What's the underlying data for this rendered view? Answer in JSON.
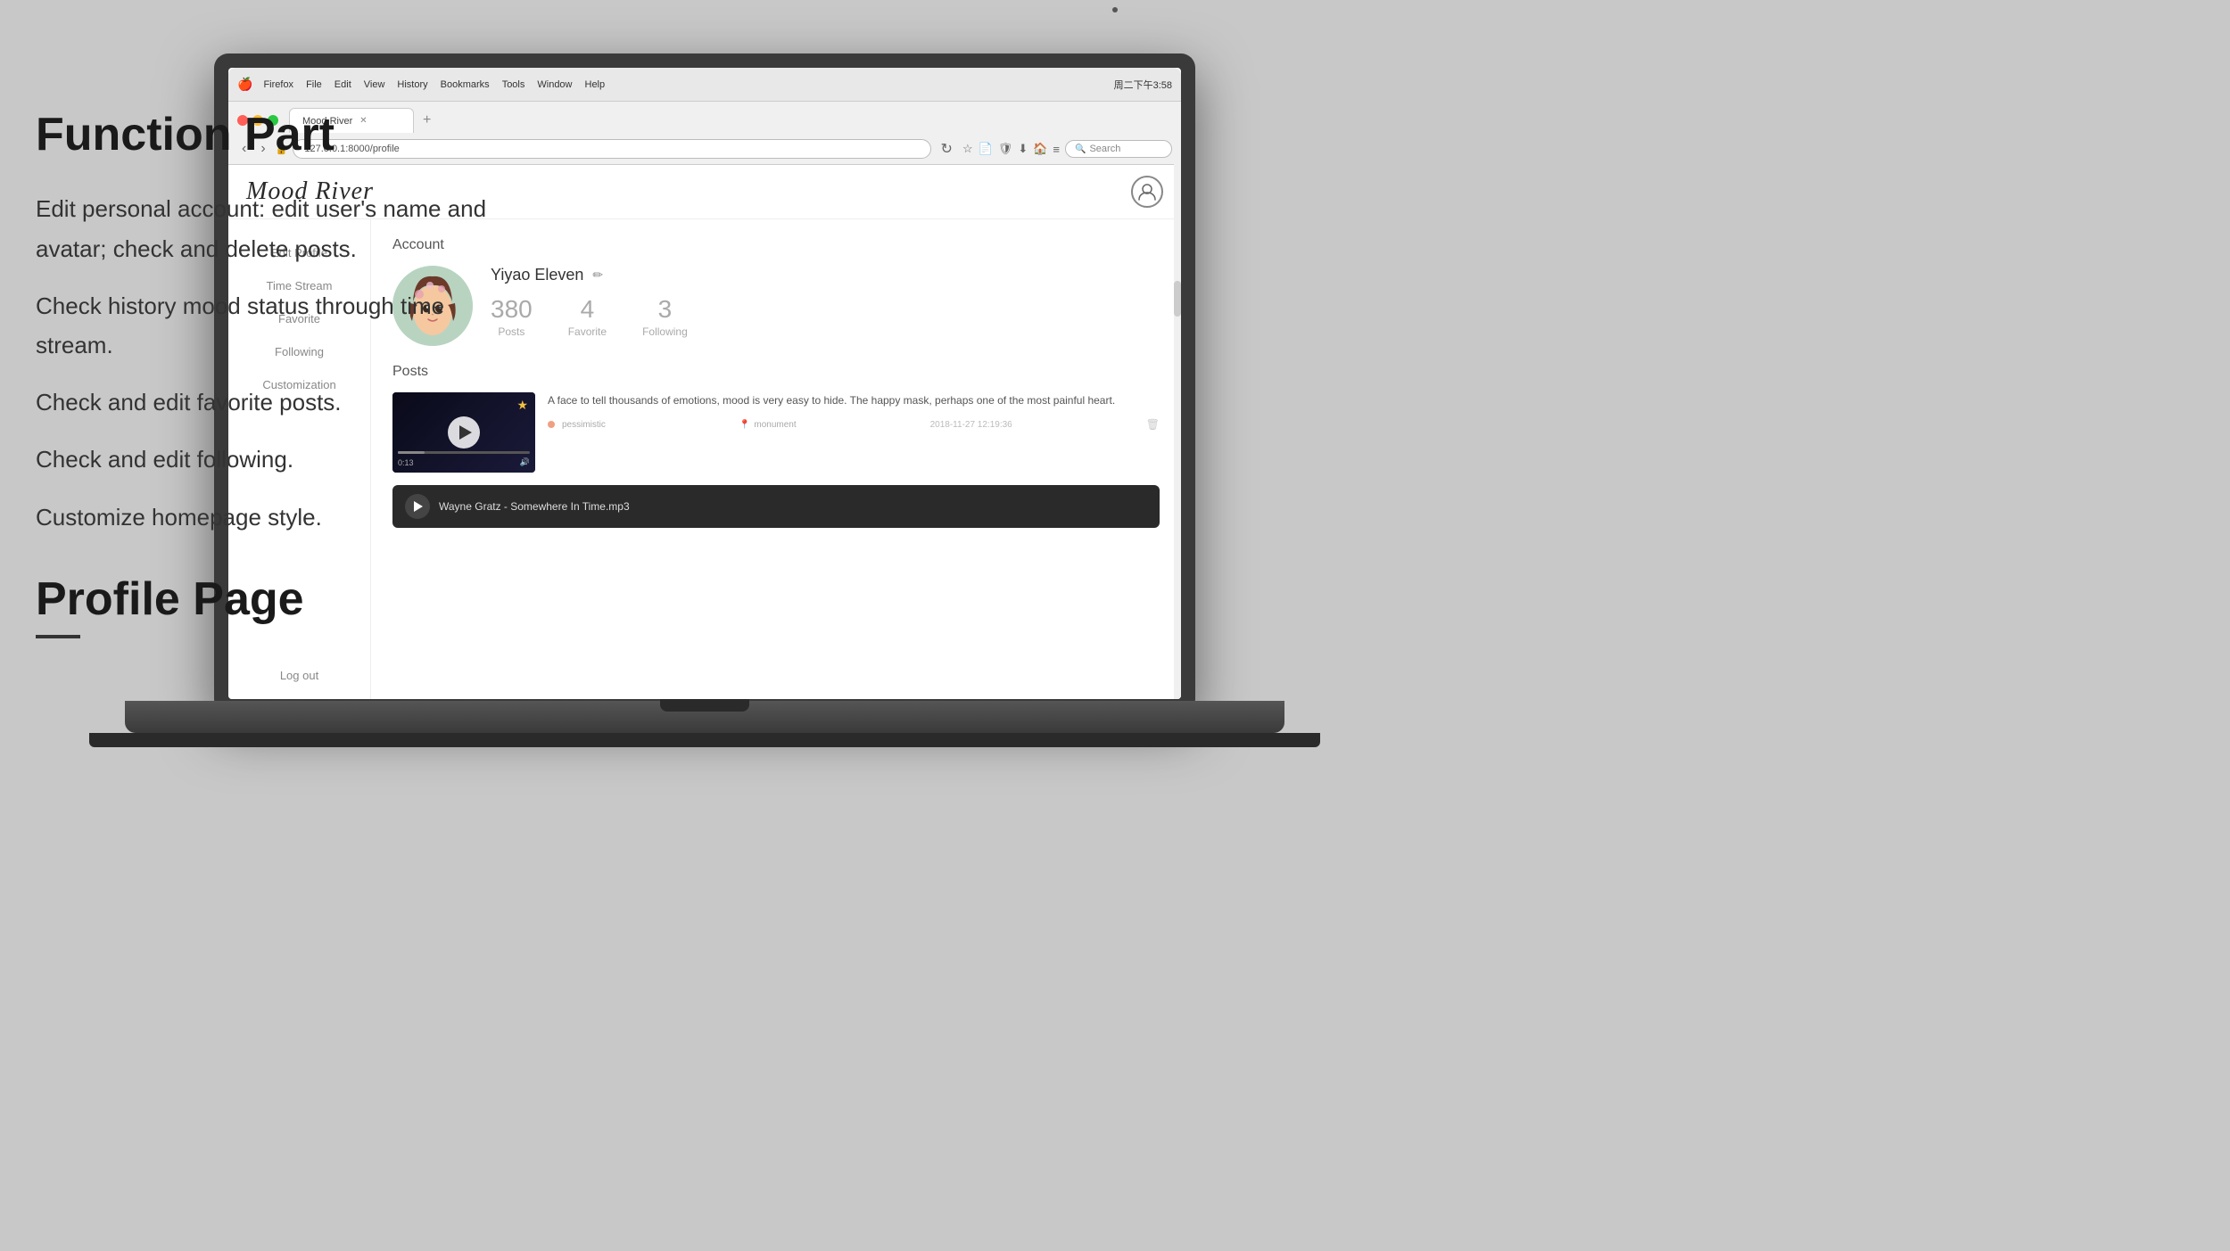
{
  "annotation": {
    "function_part_title": "Function Part",
    "description_1": "Edit personal account: edit user's name and avatar; check and delete posts.",
    "description_2": "Check history mood status through time stream.",
    "description_3": "Check and edit favorite posts.",
    "description_4": "Check and edit following.",
    "description_5": "Customize homepage style.",
    "profile_page_title": "Profile Page"
  },
  "browser": {
    "tab_title": "Mood River",
    "url": "127.0.0.1:8000/profile",
    "search_placeholder": "Search",
    "time": "周二下午3:58"
  },
  "app": {
    "logo": "Mood River",
    "header_user_icon": "👤"
  },
  "sidebar": {
    "items": [
      {
        "label": "Edit Profile",
        "active": false
      },
      {
        "label": "Time Stream",
        "active": false
      },
      {
        "label": "Favorite",
        "active": false
      },
      {
        "label": "Following",
        "active": false
      },
      {
        "label": "Customization",
        "active": false
      }
    ],
    "logout": "Log out"
  },
  "account": {
    "section_title": "Account",
    "user_name": "Yiyao Eleven",
    "stats": {
      "posts_count": "380",
      "posts_label": "Posts",
      "favorite_count": "4",
      "favorite_label": "Favorite",
      "following_count": "3",
      "following_label": "Following"
    }
  },
  "posts": {
    "section_title": "Posts",
    "items": [
      {
        "text": "A face to tell thousands of emotions, mood is very easy to hide. The happy mask, perhaps one of the most painful heart.",
        "mood": "pessimistic",
        "location": "monument",
        "timestamp": "2018-11-27 12:19:36"
      }
    ]
  },
  "music_player": {
    "title": "Wayne Gratz - Somewhere In Time.mp3"
  },
  "mac_menu": [
    "Firefox",
    "File",
    "Edit",
    "View",
    "History",
    "Bookmarks",
    "Tools",
    "Window",
    "Help"
  ]
}
